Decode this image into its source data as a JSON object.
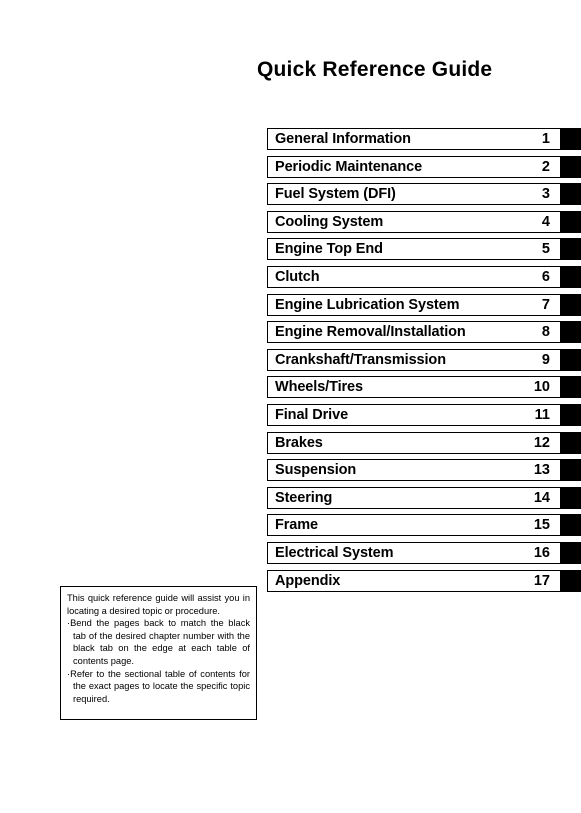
{
  "document": {
    "title": "Quick Reference Guide"
  },
  "chapter_index": [
    {
      "title": "General Information",
      "number": "1"
    },
    {
      "title": "Periodic Maintenance",
      "number": "2"
    },
    {
      "title": "Fuel System (DFI)",
      "number": "3"
    },
    {
      "title": "Cooling System",
      "number": "4"
    },
    {
      "title": "Engine Top End",
      "number": "5"
    },
    {
      "title": "Clutch",
      "number": "6"
    },
    {
      "title": "Engine Lubrication System",
      "number": "7"
    },
    {
      "title": "Engine Removal/Installation",
      "number": "8"
    },
    {
      "title": "Crankshaft/Transmission",
      "number": "9"
    },
    {
      "title": "Wheels/Tires",
      "number": "10"
    },
    {
      "title": "Final Drive",
      "number": "11"
    },
    {
      "title": "Brakes",
      "number": "12"
    },
    {
      "title": "Suspension",
      "number": "13"
    },
    {
      "title": "Steering",
      "number": "14"
    },
    {
      "title": "Frame",
      "number": "15"
    },
    {
      "title": "Electrical System",
      "number": "16"
    },
    {
      "title": "Appendix",
      "number": "17"
    }
  ],
  "note": {
    "intro": "This quick reference guide will assist you in locating a desired topic or procedure.",
    "bullet_mark": "·",
    "bullets": [
      "Bend the pages back to match the black tab of the desired chapter number with the black tab on the edge at each table of contents page.",
      "Refer to the sectional table of contents for the exact pages to locate the specific topic required."
    ]
  },
  "colors": {
    "ink": "#000000",
    "page": "#ffffff",
    "tab": "#000000"
  }
}
